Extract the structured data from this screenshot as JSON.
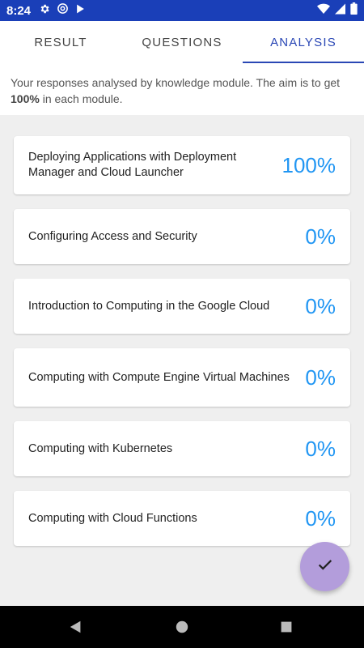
{
  "status_bar": {
    "time": "8:24",
    "icons": [
      "settings-icon",
      "at-sign-icon",
      "play-store-icon",
      "wifi-icon",
      "signal-icon",
      "battery-icon"
    ],
    "color": "#1a3fb8"
  },
  "tabs": [
    {
      "label": "RESULT",
      "active": false
    },
    {
      "label": "QUESTIONS",
      "active": false
    },
    {
      "label": "ANALYSIS",
      "active": true
    }
  ],
  "intro": {
    "text_before": "Your responses analysed by knowledge module. The aim is to get ",
    "target": "100%",
    "text_after": " in each module."
  },
  "modules": [
    {
      "title": "Deploying Applications with Deployment Manager and Cloud Launcher",
      "percent": "100%"
    },
    {
      "title": "Configuring Access and Security",
      "percent": "0%"
    },
    {
      "title": "Introduction to Computing in the Google Cloud",
      "percent": "0%"
    },
    {
      "title": "Computing with Compute Engine Virtual Machines",
      "percent": "0%"
    },
    {
      "title": "Computing with Kubernetes",
      "percent": "0%"
    },
    {
      "title": "Computing with Cloud Functions",
      "percent": "0%"
    }
  ],
  "fab": {
    "icon": "checkmark-icon",
    "color": "#b39ddb"
  },
  "nav_bar": {
    "icons": [
      "back-icon",
      "home-icon",
      "recents-icon"
    ]
  },
  "colors": {
    "accent": "#2a47b5",
    "percent": "#2196f3"
  }
}
